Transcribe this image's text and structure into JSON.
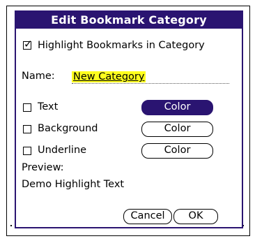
{
  "dialog": {
    "title": "Edit Bookmark Category",
    "highlight": {
      "label": "Highlight Bookmarks in Category",
      "checked": true
    },
    "name": {
      "label": "Name:",
      "value": "New Category"
    },
    "color_rows": [
      {
        "label": "Text",
        "checked": false,
        "button_label": "Color",
        "button_selected": true
      },
      {
        "label": "Background",
        "checked": false,
        "button_label": "Color",
        "button_selected": false
      },
      {
        "label": "Underline",
        "checked": false,
        "button_label": "Color",
        "button_selected": false
      }
    ],
    "preview": {
      "label": "Preview:",
      "text": "Demo Highlight Text"
    },
    "buttons": {
      "cancel": "Cancel",
      "ok": "OK"
    }
  },
  "colors": {
    "title_bar": "#2a1471",
    "name_highlight": "#ffff1e"
  }
}
